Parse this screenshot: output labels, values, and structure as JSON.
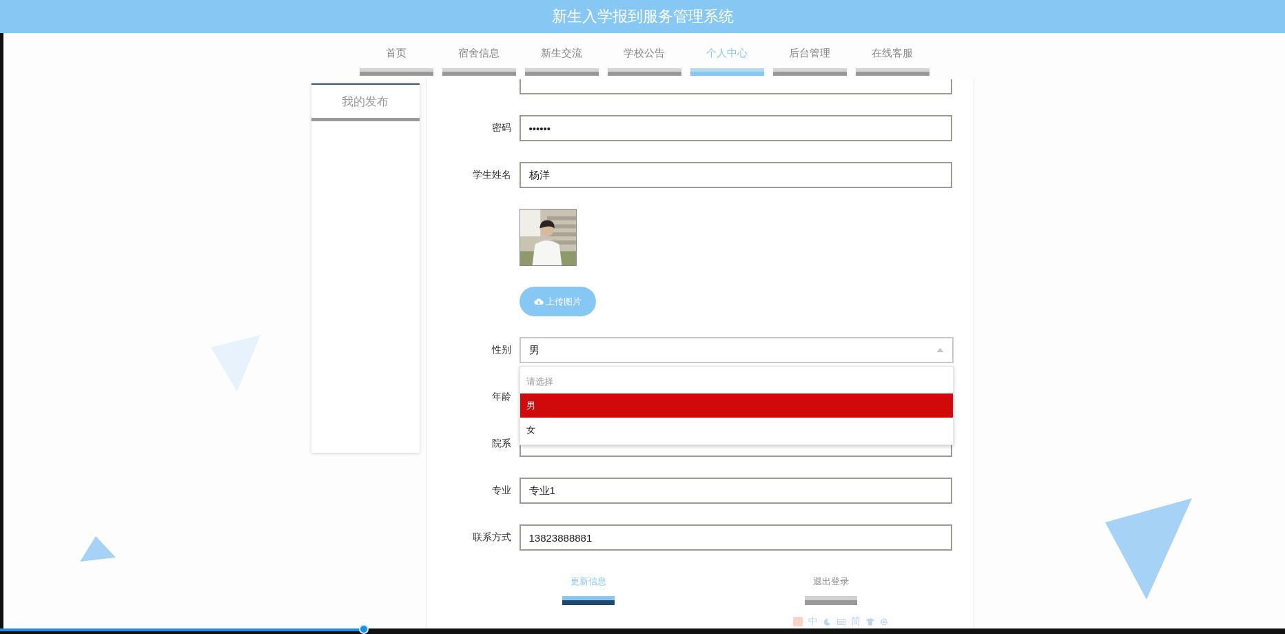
{
  "header": {
    "title": "新生入学报到服务管理系统"
  },
  "nav": [
    {
      "label": "首页",
      "selected": false
    },
    {
      "label": "宿舍信息",
      "selected": false
    },
    {
      "label": "新生交流",
      "selected": false
    },
    {
      "label": "学校公告",
      "selected": false
    },
    {
      "label": "个人中心",
      "selected": true
    },
    {
      "label": "后台管理",
      "selected": false
    },
    {
      "label": "在线客服",
      "selected": false
    }
  ],
  "sidebar": {
    "items": [
      {
        "label": "我的发布"
      }
    ]
  },
  "form": {
    "fields": [
      {
        "kind": "cut"
      },
      {
        "kind": "input",
        "label": "密码",
        "value": "••••••"
      },
      {
        "kind": "input",
        "label": "学生姓名",
        "value": "杨洋"
      },
      {
        "kind": "picture"
      },
      {
        "kind": "upload",
        "button": "上传图片"
      },
      {
        "kind": "select",
        "label": "性别",
        "value": "男",
        "expanded": true,
        "options": [
          {
            "label": "请选择",
            "kind": "hint",
            "selected": false
          },
          {
            "label": "男",
            "kind": "option",
            "selected": true
          },
          {
            "label": "女",
            "kind": "option",
            "selected": false
          }
        ]
      },
      {
        "kind": "covered",
        "label": "年龄"
      },
      {
        "kind": "covered",
        "label": "院系"
      },
      {
        "kind": "input",
        "label": "专业",
        "value": "专业1"
      },
      {
        "kind": "input",
        "label": "联系方式",
        "value": "13823888881"
      }
    ],
    "buttons": [
      {
        "label": "更新信息",
        "selected": true
      },
      {
        "label": "退出登录",
        "selected": false
      }
    ]
  },
  "ime": {
    "items": [
      "中",
      "简"
    ]
  },
  "player": {
    "level": 0.283
  }
}
